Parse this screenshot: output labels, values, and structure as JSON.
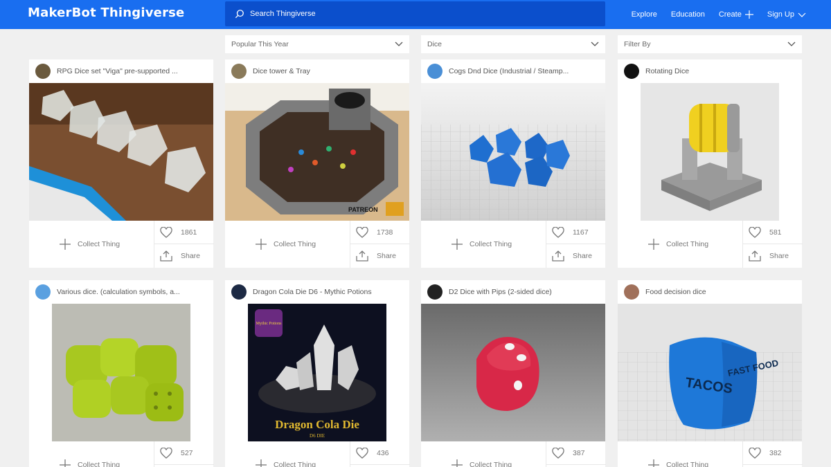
{
  "header": {
    "logo_bold": "MakerBot",
    "logo_light": "Thingiverse",
    "search_placeholder": "Search Thingiverse",
    "nav": [
      "Explore",
      "Education",
      "Create",
      "Sign Up"
    ]
  },
  "filters": [
    "Popular This Year",
    "Dice",
    "Filter By"
  ],
  "card_labels": {
    "collect": "Collect Thing",
    "share": "Share"
  },
  "cards": [
    {
      "title": "RPG Dice set \"Viga\" pre-supported ...",
      "likes": "1861",
      "avatar_color": "#6b5a3e"
    },
    {
      "title": "Dice tower & Tray",
      "likes": "1738",
      "avatar_color": "#8a7a5a"
    },
    {
      "title": "Cogs Dnd Dice (Industrial / Steamp...",
      "likes": "1167",
      "avatar_color": "#4a8fd6"
    },
    {
      "title": "Rotating Dice",
      "likes": "581",
      "avatar_color": "#111111"
    },
    {
      "title": "Various dice. (calculation symbols, a...",
      "likes": "527",
      "avatar_color": "#5aa0e0"
    },
    {
      "title": "Dragon Cola Die D6 - Mythic Potions",
      "likes": "436",
      "avatar_color": "#1d2a44"
    },
    {
      "title": "D2 Dice with Pips (2-sided dice)",
      "likes": "387",
      "avatar_color": "#222222"
    },
    {
      "title": "Food decision dice",
      "likes": "382",
      "avatar_color": "#a0705a"
    }
  ],
  "image_text": {
    "patreon": "PATREON",
    "mythic": "Mythic Potions",
    "dragon": "Dragon Cola Die",
    "d6die": "D6 DIE",
    "tacos": "TACOS",
    "fastfood": "FAST FOOD"
  },
  "colors": {
    "header": "#196ef0",
    "search": "#0b4fcc",
    "background": "#f0f0f0"
  }
}
